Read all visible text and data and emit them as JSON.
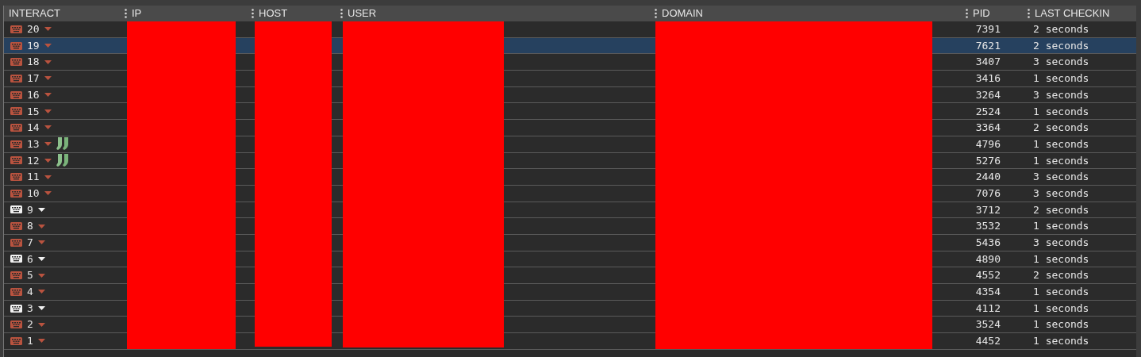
{
  "columns": [
    {
      "label": "INTERACT",
      "redacted": false
    },
    {
      "label": "IP",
      "redacted": true
    },
    {
      "label": "HOST",
      "redacted": true
    },
    {
      "label": "USER",
      "redacted": true
    },
    {
      "label": "DOMAIN",
      "redacted": true
    },
    {
      "label": "PID",
      "redacted": false
    },
    {
      "label": "LAST CHECKIN",
      "redacted": false
    }
  ],
  "rows": [
    {
      "id": "20",
      "active": false,
      "socks": false,
      "selected": false,
      "pid": "7391",
      "checkin": "2 seconds"
    },
    {
      "id": "19",
      "active": false,
      "socks": false,
      "selected": true,
      "pid": "7621",
      "checkin": "2 seconds"
    },
    {
      "id": "18",
      "active": false,
      "socks": false,
      "selected": false,
      "pid": "3407",
      "checkin": "3 seconds"
    },
    {
      "id": "17",
      "active": false,
      "socks": false,
      "selected": false,
      "pid": "3416",
      "checkin": "1 seconds"
    },
    {
      "id": "16",
      "active": false,
      "socks": false,
      "selected": false,
      "pid": "3264",
      "checkin": "3 seconds"
    },
    {
      "id": "15",
      "active": false,
      "socks": false,
      "selected": false,
      "pid": "2524",
      "checkin": "1 seconds"
    },
    {
      "id": "14",
      "active": false,
      "socks": false,
      "selected": false,
      "pid": "3364",
      "checkin": "2 seconds"
    },
    {
      "id": "13",
      "active": false,
      "socks": true,
      "selected": false,
      "pid": "4796",
      "checkin": "1 seconds"
    },
    {
      "id": "12",
      "active": false,
      "socks": true,
      "selected": false,
      "pid": "5276",
      "checkin": "1 seconds"
    },
    {
      "id": "11",
      "active": false,
      "socks": false,
      "selected": false,
      "pid": "2440",
      "checkin": "3 seconds"
    },
    {
      "id": "10",
      "active": false,
      "socks": false,
      "selected": false,
      "pid": "7076",
      "checkin": "3 seconds"
    },
    {
      "id": "9",
      "active": true,
      "socks": false,
      "selected": false,
      "pid": "3712",
      "checkin": "2 seconds"
    },
    {
      "id": "8",
      "active": false,
      "socks": false,
      "selected": false,
      "pid": "3532",
      "checkin": "1 seconds"
    },
    {
      "id": "7",
      "active": false,
      "socks": false,
      "selected": false,
      "pid": "5436",
      "checkin": "3 seconds"
    },
    {
      "id": "6",
      "active": true,
      "socks": false,
      "selected": false,
      "pid": "4890",
      "checkin": "1 seconds"
    },
    {
      "id": "5",
      "active": false,
      "socks": false,
      "selected": false,
      "pid": "4552",
      "checkin": "2 seconds"
    },
    {
      "id": "4",
      "active": false,
      "socks": false,
      "selected": false,
      "pid": "4354",
      "checkin": "1 seconds"
    },
    {
      "id": "3",
      "active": true,
      "socks": false,
      "selected": false,
      "pid": "4112",
      "checkin": "1 seconds"
    },
    {
      "id": "2",
      "active": false,
      "socks": false,
      "selected": false,
      "pid": "3524",
      "checkin": "1 seconds"
    },
    {
      "id": "1",
      "active": false,
      "socks": false,
      "selected": false,
      "pid": "4452",
      "checkin": "1 seconds"
    }
  ]
}
